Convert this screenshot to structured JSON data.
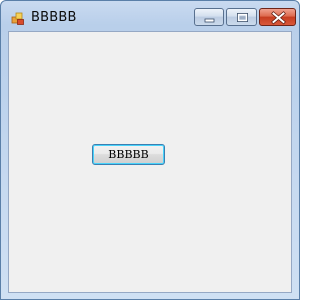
{
  "window": {
    "title": "BBBBB",
    "app_icon": "windows-form-icon",
    "controls": {
      "minimize_icon": "minimize-icon",
      "maximize_icon": "maximize-icon",
      "close_icon": "close-icon"
    }
  },
  "content": {
    "button_label": "BBBBB"
  },
  "colors": {
    "client_background": "#f0f0f0",
    "close_button": "#c63d20",
    "button_focus_border": "#3c7fb1"
  }
}
